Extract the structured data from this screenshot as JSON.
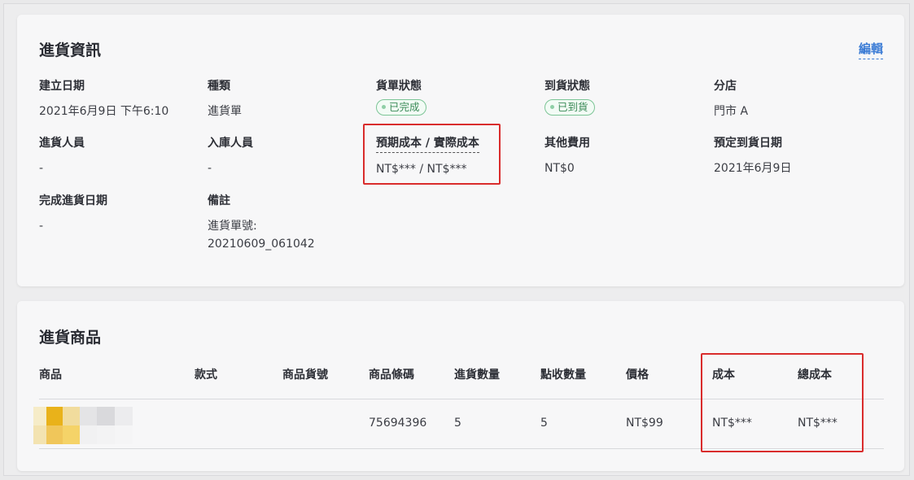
{
  "info_card": {
    "title": "進貨資訊",
    "edit_label": "編輯",
    "fields": {
      "created_date": {
        "label": "建立日期",
        "value": "2021年6月9日 下午6:10"
      },
      "type": {
        "label": "種類",
        "value": "進貨單"
      },
      "order_status": {
        "label": "貨單狀態",
        "badge": "已完成"
      },
      "arrival_status": {
        "label": "到貨狀態",
        "badge": "已到貨"
      },
      "branch": {
        "label": "分店",
        "value": "門市 A"
      },
      "purchaser": {
        "label": "進貨人員",
        "value": "-"
      },
      "receiver": {
        "label": "入庫人員",
        "value": "-"
      },
      "cost": {
        "label": "預期成本 / 實際成本",
        "value": "NT$*** / NT$***"
      },
      "other_fees": {
        "label": "其他費用",
        "value": "NT$0"
      },
      "expected_arrival": {
        "label": "預定到貨日期",
        "value": "2021年6月9日"
      },
      "completed_date": {
        "label": "完成進貨日期",
        "value": "-"
      },
      "remarks": {
        "label": "備註",
        "line1": "進貨單號:",
        "line2": "20210609_061042"
      }
    }
  },
  "items_card": {
    "title": "進貨商品",
    "columns": [
      "商品",
      "款式",
      "商品貨號",
      "商品條碼",
      "進貨數量",
      "點收數量",
      "價格",
      "成本",
      "總成本"
    ],
    "rows": [
      {
        "product": "",
        "style": "",
        "sku": "",
        "barcode": "75694396",
        "ordered_qty": "5",
        "received_qty": "5",
        "price": "NT$99",
        "cost": "NT$***",
        "total_cost": "NT$***"
      }
    ]
  },
  "colors": {
    "highlight_box": "#d92c2c",
    "link": "#3a7bd5",
    "badge_green": "#3a8a57",
    "thumbnail_accent": "#e9b21a"
  }
}
